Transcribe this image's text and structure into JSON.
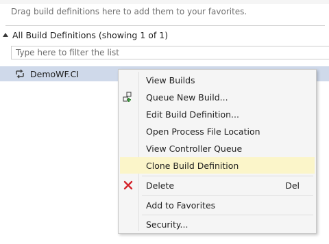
{
  "favorites": {
    "hint": "Drag build definitions here to add them to your favorites."
  },
  "section": {
    "title": "All Build Definitions (showing 1 of 1)"
  },
  "filter": {
    "placeholder": "Type here to filter the list",
    "value": ""
  },
  "build": {
    "name": "DemoWF.CI"
  },
  "context_menu": {
    "items": [
      {
        "label": "View Builds",
        "shortcut": ""
      },
      {
        "label": "Queue New Build...",
        "shortcut": "",
        "icon": "queue-build-icon"
      },
      {
        "label": "Edit Build Definition...",
        "shortcut": ""
      },
      {
        "label": "Open Process File Location",
        "shortcut": ""
      },
      {
        "label": "View Controller Queue",
        "shortcut": ""
      },
      {
        "label": "Clone Build Definition",
        "shortcut": "",
        "highlighted": true
      },
      {
        "label": "Delete",
        "shortcut": "Del",
        "icon": "delete-x-icon"
      },
      {
        "label": "Add to Favorites",
        "shortcut": ""
      },
      {
        "label": "Security...",
        "shortcut": ""
      }
    ]
  },
  "colors": {
    "selection": "#cfd9ea",
    "menu_highlight": "#fbf5c9",
    "delete_icon": "#d4222a",
    "queue_icon": "#3a8f3a"
  }
}
